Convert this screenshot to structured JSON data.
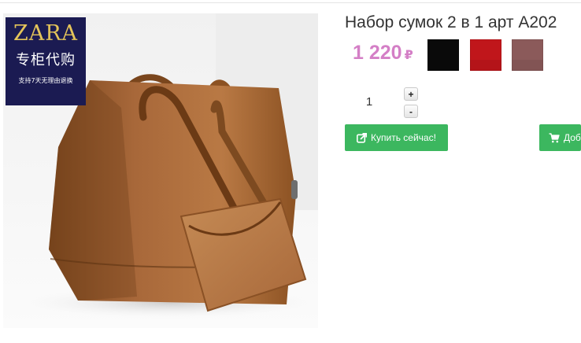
{
  "product": {
    "title": "Набор сумок 2 в 1 арт A202",
    "price": "1 220",
    "currency": "₽"
  },
  "photo_badge": {
    "logo": "ZARA",
    "line1": "专柜代购",
    "line2": "支持7天无理由退换"
  },
  "colors": [
    {
      "name": "black",
      "hex": "#0a0a0a"
    },
    {
      "name": "red",
      "hex": "#c0161b"
    },
    {
      "name": "brown",
      "hex": "#8b5a5a"
    }
  ],
  "quantity": {
    "value": "1",
    "plus_label": "+",
    "minus_label": "-"
  },
  "buttons": {
    "buy_now": "Купить сейчас!",
    "add_to_cart": "Доб",
    "buy_icon": "external-link-icon",
    "cart_icon": "shopping-cart-icon",
    "color": "#3cb75f"
  }
}
